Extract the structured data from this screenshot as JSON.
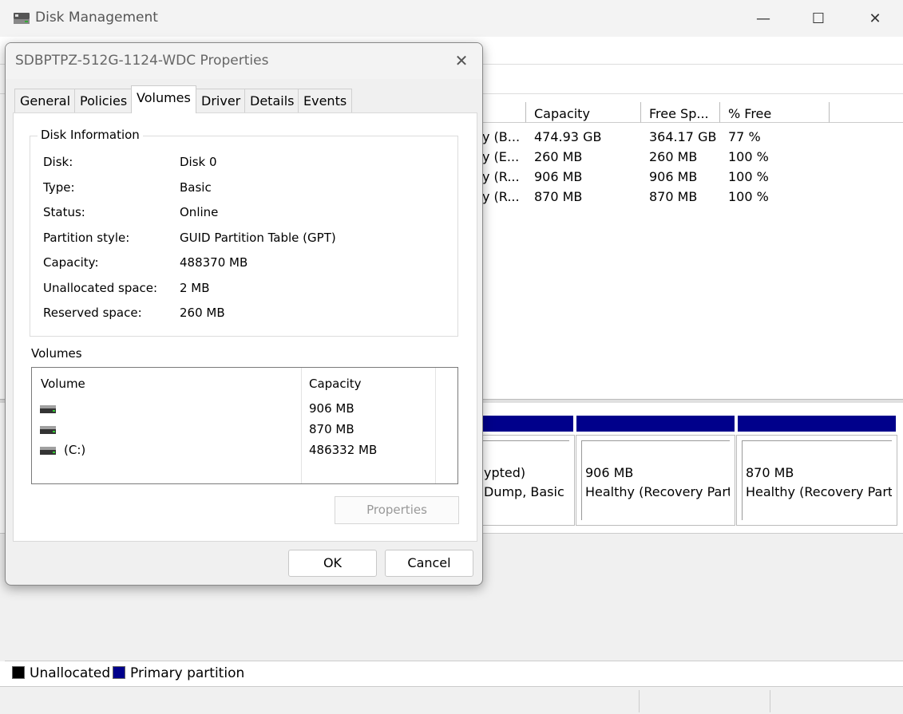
{
  "window": {
    "title": "Disk Management",
    "minimize": "—",
    "maximize": "☐",
    "close": "✕"
  },
  "volume_list": {
    "columns": [
      "Capacity",
      "Free Sp...",
      "% Free"
    ],
    "rows": [
      {
        "status": "y (B...",
        "capacity": "474.93 GB",
        "free": "364.17 GB",
        "pct": "77 %"
      },
      {
        "status": "y (E...",
        "capacity": "260 MB",
        "free": "260 MB",
        "pct": "100 %"
      },
      {
        "status": "y (R...",
        "capacity": "906 MB",
        "free": "906 MB",
        "pct": "100 %"
      },
      {
        "status": "y (R...",
        "capacity": "870 MB",
        "free": "870 MB",
        "pct": "100 %"
      }
    ]
  },
  "disk_map": {
    "partitions": [
      {
        "line1": "ypted)",
        "line2": "Dump, Basic D"
      },
      {
        "line1": "906 MB",
        "line2": "Healthy (Recovery Part"
      },
      {
        "line1": "870 MB",
        "line2": "Healthy (Recovery Part"
      }
    ]
  },
  "legend": {
    "unallocated": "Unallocated",
    "primary": "Primary partition",
    "unallocated_color": "#000000",
    "primary_color": "#00008b"
  },
  "dialog": {
    "title": "SDBPTPZ-512G-1124-WDC Properties",
    "close": "✕",
    "tabs": [
      "General",
      "Policies",
      "Volumes",
      "Driver",
      "Details",
      "Events"
    ],
    "active_tab": "Volumes",
    "disk_info": {
      "group_label": "Disk Information",
      "fields": [
        {
          "label": "Disk:",
          "value": "Disk 0"
        },
        {
          "label": "Type:",
          "value": "Basic"
        },
        {
          "label": "Status:",
          "value": "Online"
        },
        {
          "label": "Partition style:",
          "value": "GUID Partition Table (GPT)"
        },
        {
          "label": "Capacity:",
          "value": "488370 MB"
        },
        {
          "label": "Unallocated space:",
          "value": "2 MB"
        },
        {
          "label": "Reserved space:",
          "value": "260 MB"
        }
      ]
    },
    "volumes": {
      "label": "Volumes",
      "header_volume": "Volume",
      "header_capacity": "Capacity",
      "rows": [
        {
          "name": "",
          "capacity": "906 MB"
        },
        {
          "name": "",
          "capacity": "870 MB"
        },
        {
          "name": "(C:)",
          "capacity": "486332 MB"
        }
      ]
    },
    "properties_button": "Properties",
    "ok_button": "OK",
    "cancel_button": "Cancel"
  }
}
